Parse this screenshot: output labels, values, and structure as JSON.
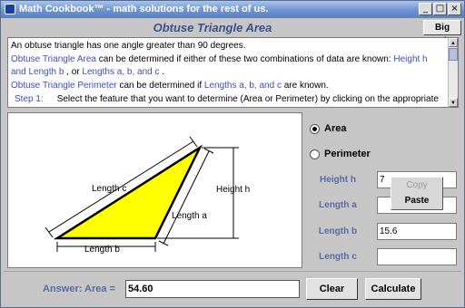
{
  "window": {
    "title": "Math Cookbook™ - math solutions for the rest of us.",
    "minimize": "_",
    "maximize": "□",
    "close": "×"
  },
  "header": {
    "title": "Obtuse Triangle Area",
    "big_help": "Big Help"
  },
  "description": {
    "line1": "An obtuse triangle has one angle greater than 90 degrees.",
    "area_link": "Obtuse Triangle Area",
    "area_text": " can be determined if either of these two combinations of data are known: ",
    "area_opt1": "Height h and Length b",
    "area_sep": " , or ",
    "area_opt2": "Lengths a, b, and c",
    "area_end": " .",
    "perim_link": "Obtuse Triangle Perimeter",
    "perim_text": " can be determined if ",
    "perim_opt": "Lengths a, b, and c",
    "perim_end": " are known.",
    "step_label": "Step 1:",
    "step_text": "Select the feature that you want to determine (Area or Perimeter) by clicking on the appropriate"
  },
  "diagram": {
    "label_c": "Length c",
    "label_a": "Length a",
    "label_b": "Length b",
    "label_h": "Height h",
    "fill_color": "#ffff00"
  },
  "options": {
    "area_label": "Area",
    "perimeter_label": "Perimeter",
    "selected": "Area"
  },
  "fields": {
    "height_h": {
      "label": "Height h",
      "value": "7"
    },
    "length_a": {
      "label": "Length a",
      "value": ""
    },
    "length_b": {
      "label": "Length b",
      "value": "15.6"
    },
    "length_c": {
      "label": "Length c",
      "value": ""
    }
  },
  "clipboard": {
    "copy": "Copy",
    "paste": "Paste"
  },
  "footer": {
    "answer_label": "Answer: Area =",
    "answer_value": "54.60",
    "clear": "Clear",
    "calculate": "Calculate"
  }
}
